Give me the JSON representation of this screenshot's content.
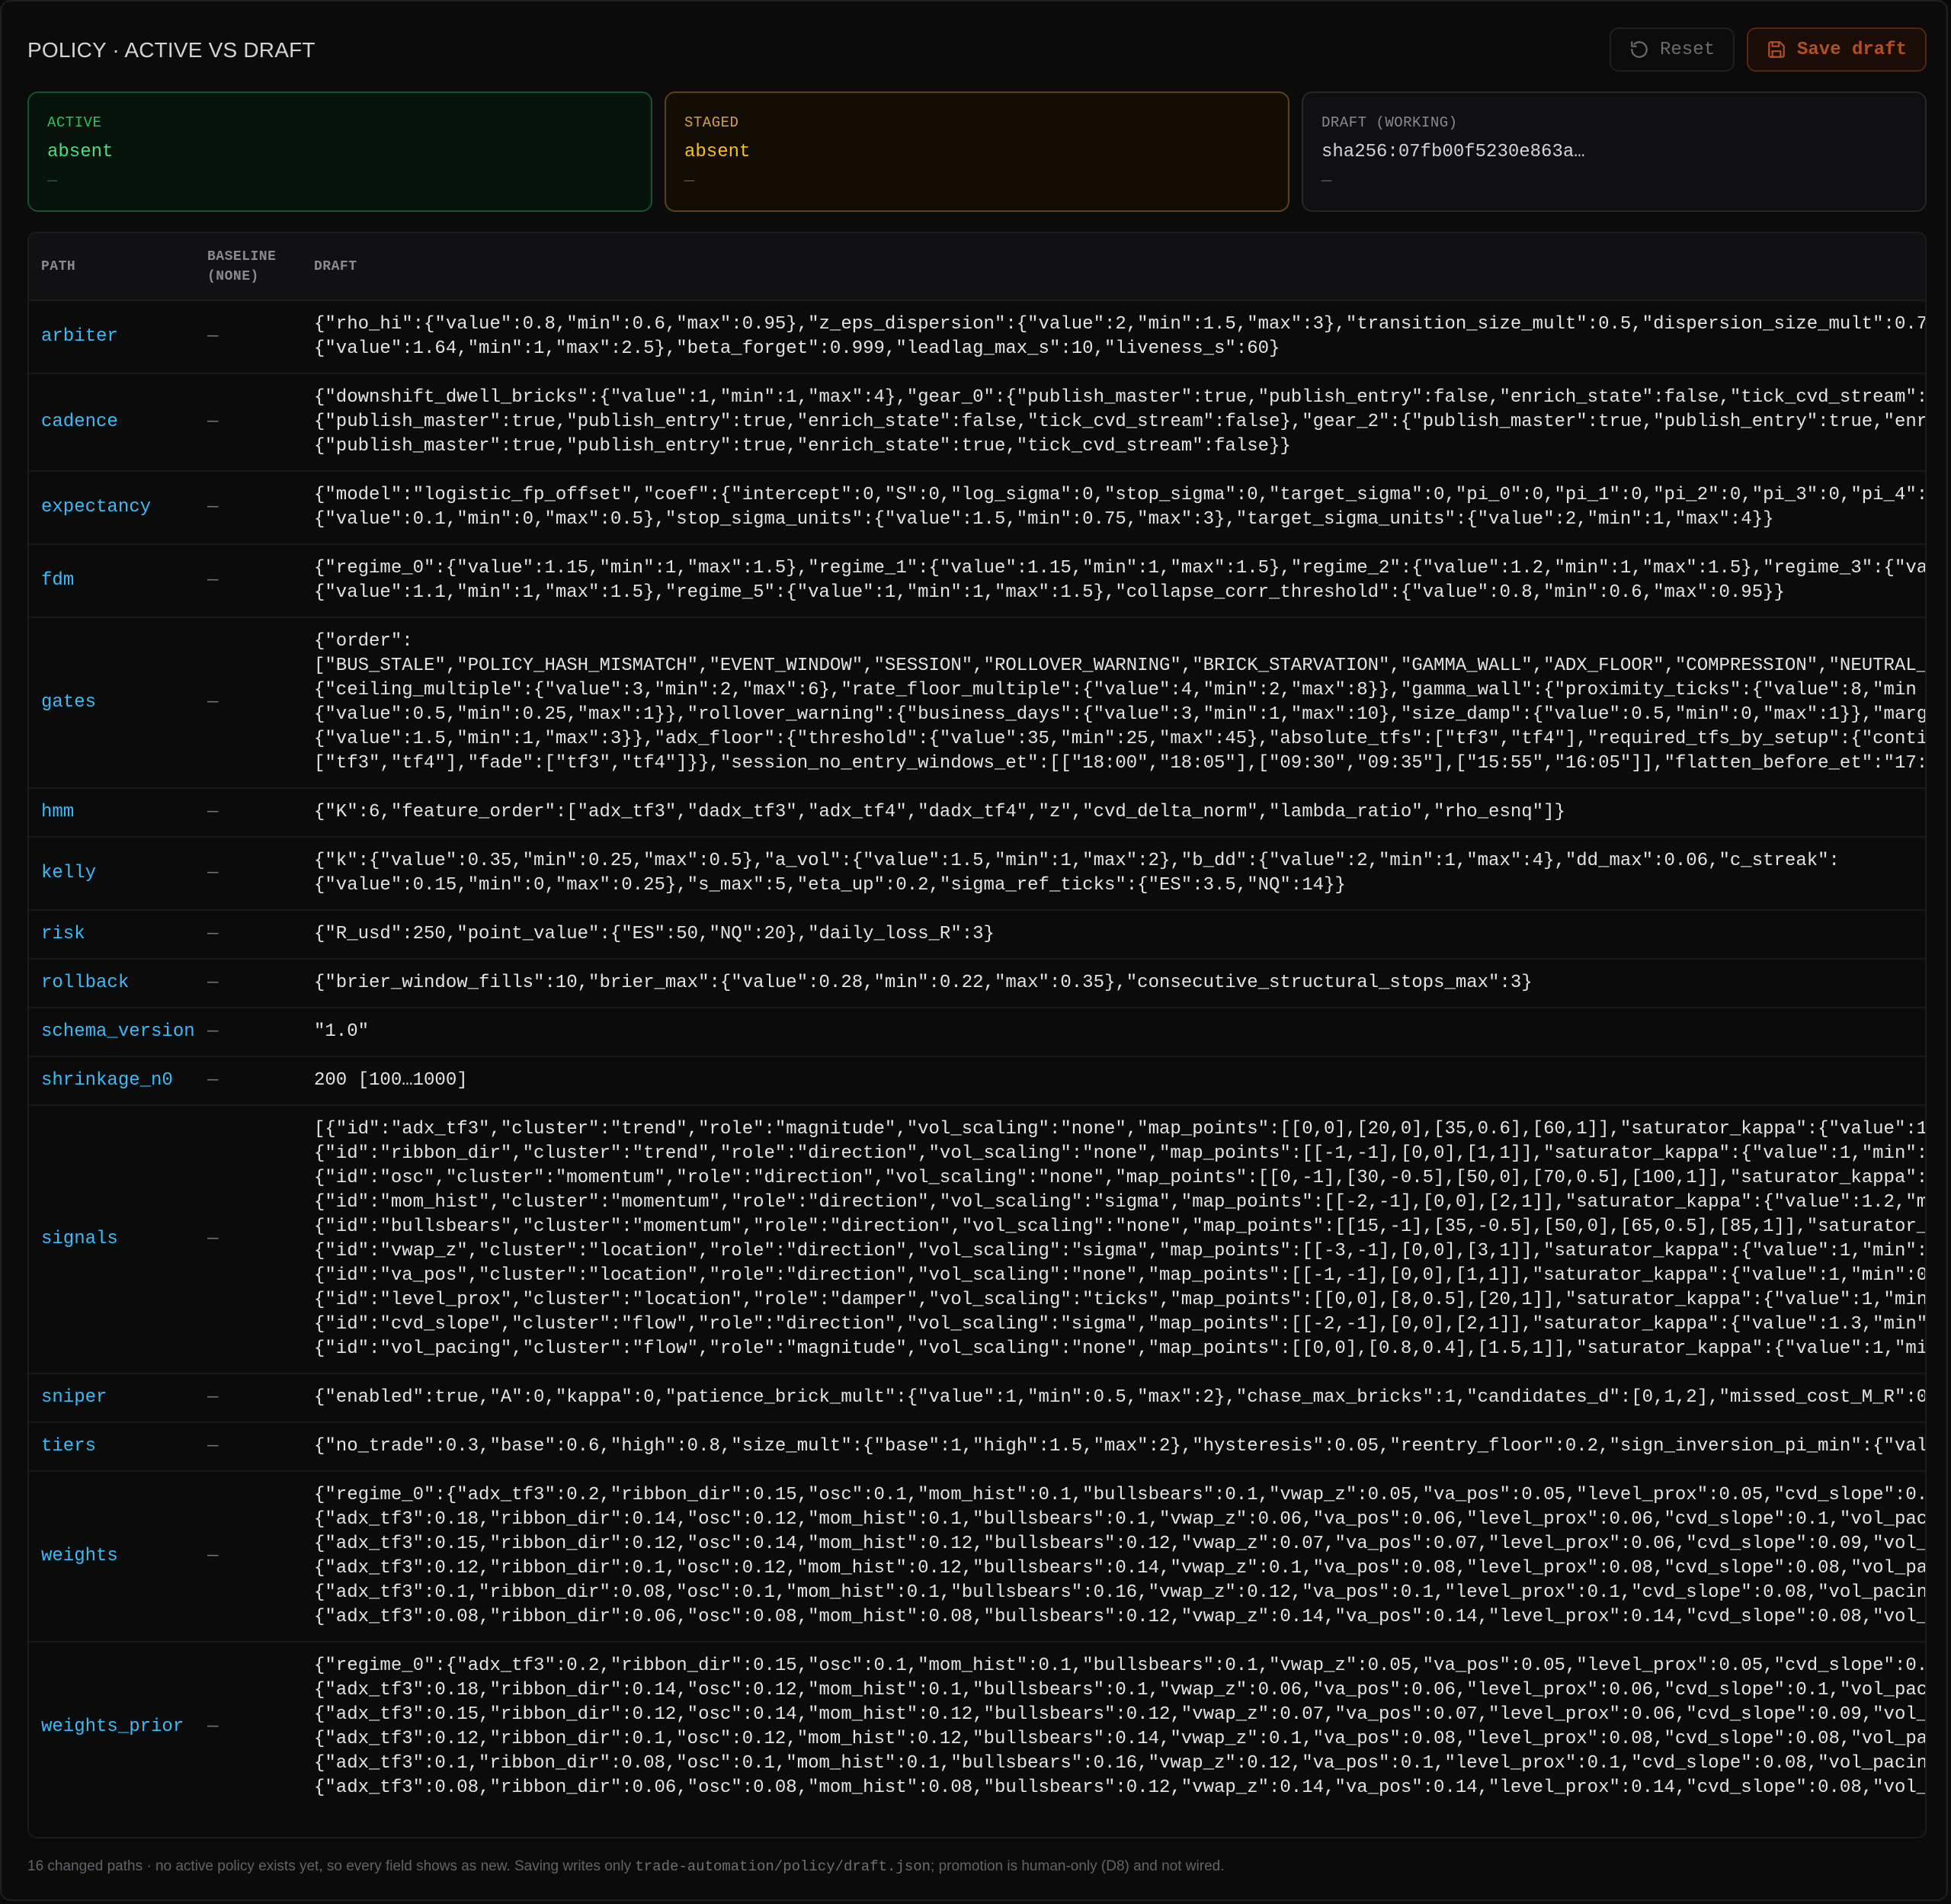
{
  "header": {
    "title": "POLICY · ACTIVE VS DRAFT",
    "reset_label": "Reset",
    "save_label": "Save draft"
  },
  "cards": {
    "active": {
      "label": "ACTIVE",
      "value": "absent",
      "sub": "—"
    },
    "staged": {
      "label": "STAGED",
      "value": "absent",
      "sub": "—"
    },
    "draft": {
      "label": "DRAFT (WORKING)",
      "value": "sha256:07fb00f5230e863a…",
      "sub": "—"
    }
  },
  "table": {
    "columns": {
      "path": "PATH",
      "baseline": "BASELINE\n(NONE)",
      "draft": "DRAFT"
    },
    "rows": [
      {
        "path": "arbiter",
        "baseline": "—",
        "draft": "{\"rho_hi\":{\"value\":0.8,\"min\":0.6,\"max\":0.95},\"z_eps_dispersion\":{\"value\":2,\"min\":1.5,\"max\":3},\"transition_size_mult\":0.5,\"dispersion_size_mult\":0.7\n{\"value\":1.64,\"min\":1,\"max\":2.5},\"beta_forget\":0.999,\"leadlag_max_s\":10,\"liveness_s\":60}"
      },
      {
        "path": "cadence",
        "baseline": "—",
        "draft": "{\"downshift_dwell_bricks\":{\"value\":1,\"min\":1,\"max\":4},\"gear_0\":{\"publish_master\":true,\"publish_entry\":false,\"enrich_state\":false,\"tick_cvd_stream\":\n{\"publish_master\":true,\"publish_entry\":true,\"enrich_state\":false,\"tick_cvd_stream\":false},\"gear_2\":{\"publish_master\":true,\"publish_entry\":true,\"enri\n{\"publish_master\":true,\"publish_entry\":true,\"enrich_state\":true,\"tick_cvd_stream\":false}}"
      },
      {
        "path": "expectancy",
        "baseline": "—",
        "draft": "{\"model\":\"logistic_fp_offset\",\"coef\":{\"intercept\":0,\"S\":0,\"log_sigma\":0,\"stop_sigma\":0,\"target_sigma\":0,\"pi_0\":0,\"pi_1\":0,\"pi_2\":0,\"pi_3\":0,\"pi_4\":\n{\"value\":0.1,\"min\":0,\"max\":0.5},\"stop_sigma_units\":{\"value\":1.5,\"min\":0.75,\"max\":3},\"target_sigma_units\":{\"value\":2,\"min\":1,\"max\":4}}"
      },
      {
        "path": "fdm",
        "baseline": "—",
        "draft": "{\"regime_0\":{\"value\":1.15,\"min\":1,\"max\":1.5},\"regime_1\":{\"value\":1.15,\"min\":1,\"max\":1.5},\"regime_2\":{\"value\":1.2,\"min\":1,\"max\":1.5},\"regime_3\":{\"va\n{\"value\":1.1,\"min\":1,\"max\":1.5},\"regime_5\":{\"value\":1,\"min\":1,\"max\":1.5},\"collapse_corr_threshold\":{\"value\":0.8,\"min\":0.6,\"max\":0.95}}"
      },
      {
        "path": "gates",
        "baseline": "—",
        "draft": "{\"order\":\n[\"BUS_STALE\",\"POLICY_HASH_MISMATCH\",\"EVENT_WINDOW\",\"SESSION\",\"ROLLOVER_WARNING\",\"BRICK_STARVATION\",\"GAMMA_WALL\",\"ADX_FLOOR\",\"COMPRESSION\",\"NEUTRAL_\n{\"ceiling_multiple\":{\"value\":3,\"min\":2,\"max\":6},\"rate_floor_multiple\":{\"value\":4,\"min\":2,\"max\":8}},\"gamma_wall\":{\"proximity_ticks\":{\"value\":8,\"min\n{\"value\":0.5,\"min\":0.25,\"max\":1}},\"rollover_warning\":{\"business_days\":{\"value\":3,\"min\":1,\"max\":10},\"size_damp\":{\"value\":0.5,\"min\":0,\"max\":1}},\"marg\n{\"value\":1.5,\"min\":1,\"max\":3}},\"adx_floor\":{\"threshold\":{\"value\":35,\"min\":25,\"max\":45},\"absolute_tfs\":[\"tf3\",\"tf4\"],\"required_tfs_by_setup\":{\"conti\n[\"tf3\",\"tf4\"],\"fade\":[\"tf3\",\"tf4\"]}},\"session_no_entry_windows_et\":[[\"18:00\",\"18:05\"],[\"09:30\",\"09:35\"],[\"15:55\",\"16:05\"]],\"flatten_before_et\":\"17:"
      },
      {
        "path": "hmm",
        "baseline": "—",
        "draft": "{\"K\":6,\"feature_order\":[\"adx_tf3\",\"dadx_tf3\",\"adx_tf4\",\"dadx_tf4\",\"z\",\"cvd_delta_norm\",\"lambda_ratio\",\"rho_esnq\"]}"
      },
      {
        "path": "kelly",
        "baseline": "—",
        "draft": "{\"k\":{\"value\":0.35,\"min\":0.25,\"max\":0.5},\"a_vol\":{\"value\":1.5,\"min\":1,\"max\":2},\"b_dd\":{\"value\":2,\"min\":1,\"max\":4},\"dd_max\":0.06,\"c_streak\":\n{\"value\":0.15,\"min\":0,\"max\":0.25},\"s_max\":5,\"eta_up\":0.2,\"sigma_ref_ticks\":{\"ES\":3.5,\"NQ\":14}}"
      },
      {
        "path": "risk",
        "baseline": "—",
        "draft": "{\"R_usd\":250,\"point_value\":{\"ES\":50,\"NQ\":20},\"daily_loss_R\":3}"
      },
      {
        "path": "rollback",
        "baseline": "—",
        "draft": "{\"brier_window_fills\":10,\"brier_max\":{\"value\":0.28,\"min\":0.22,\"max\":0.35},\"consecutive_structural_stops_max\":3}"
      },
      {
        "path": "schema_version",
        "baseline": "—",
        "draft": "\"1.0\""
      },
      {
        "path": "shrinkage_n0",
        "baseline": "—",
        "draft": "200 [100…1000]"
      },
      {
        "path": "signals",
        "baseline": "—",
        "draft": "[{\"id\":\"adx_tf3\",\"cluster\":\"trend\",\"role\":\"magnitude\",\"vol_scaling\":\"none\",\"map_points\":[[0,0],[20,0],[35,0.6],[60,1]],\"saturator_kappa\":{\"value\":1\n{\"id\":\"ribbon_dir\",\"cluster\":\"trend\",\"role\":\"direction\",\"vol_scaling\":\"none\",\"map_points\":[[-1,-1],[0,0],[1,1]],\"saturator_kappa\":{\"value\":1,\"min\":\n{\"id\":\"osc\",\"cluster\":\"momentum\",\"role\":\"direction\",\"vol_scaling\":\"none\",\"map_points\":[[0,-1],[30,-0.5],[50,0],[70,0.5],[100,1]],\"saturator_kappa\":\n{\"id\":\"mom_hist\",\"cluster\":\"momentum\",\"role\":\"direction\",\"vol_scaling\":\"sigma\",\"map_points\":[[-2,-1],[0,0],[2,1]],\"saturator_kappa\":{\"value\":1.2,\"m\n{\"id\":\"bullsbears\",\"cluster\":\"momentum\",\"role\":\"direction\",\"vol_scaling\":\"none\",\"map_points\":[[15,-1],[35,-0.5],[50,0],[65,0.5],[85,1]],\"saturator_\n{\"id\":\"vwap_z\",\"cluster\":\"location\",\"role\":\"direction\",\"vol_scaling\":\"sigma\",\"map_points\":[[-3,-1],[0,0],[3,1]],\"saturator_kappa\":{\"value\":1,\"min\":\n{\"id\":\"va_pos\",\"cluster\":\"location\",\"role\":\"direction\",\"vol_scaling\":\"none\",\"map_points\":[[-1,-1],[0,0],[1,1]],\"saturator_kappa\":{\"value\":1,\"min\":0\n{\"id\":\"level_prox\",\"cluster\":\"location\",\"role\":\"damper\",\"vol_scaling\":\"ticks\",\"map_points\":[[0,0],[8,0.5],[20,1]],\"saturator_kappa\":{\"value\":1,\"min\n{\"id\":\"cvd_slope\",\"cluster\":\"flow\",\"role\":\"direction\",\"vol_scaling\":\"sigma\",\"map_points\":[[-2,-1],[0,0],[2,1]],\"saturator_kappa\":{\"value\":1.3,\"min\"\n{\"id\":\"vol_pacing\",\"cluster\":\"flow\",\"role\":\"magnitude\",\"vol_scaling\":\"none\",\"map_points\":[[0,0],[0.8,0.4],[1.5,1]],\"saturator_kappa\":{\"value\":1,\"mi"
      },
      {
        "path": "sniper",
        "baseline": "—",
        "draft": "{\"enabled\":true,\"A\":0,\"kappa\":0,\"patience_brick_mult\":{\"value\":1,\"min\":0.5,\"max\":2},\"chase_max_bricks\":1,\"candidates_d\":[0,1,2],\"missed_cost_M_R\":0"
      },
      {
        "path": "tiers",
        "baseline": "—",
        "draft": "{\"no_trade\":0.3,\"base\":0.6,\"high\":0.8,\"size_mult\":{\"base\":1,\"high\":1.5,\"max\":2},\"hysteresis\":0.05,\"reentry_floor\":0.2,\"sign_inversion_pi_min\":{\"val"
      },
      {
        "path": "weights",
        "baseline": "—",
        "draft": "{\"regime_0\":{\"adx_tf3\":0.2,\"ribbon_dir\":0.15,\"osc\":0.1,\"mom_hist\":0.1,\"bullsbears\":0.1,\"vwap_z\":0.05,\"va_pos\":0.05,\"level_prox\":0.05,\"cvd_slope\":0.\n{\"adx_tf3\":0.18,\"ribbon_dir\":0.14,\"osc\":0.12,\"mom_hist\":0.1,\"bullsbears\":0.1,\"vwap_z\":0.06,\"va_pos\":0.06,\"level_prox\":0.06,\"cvd_slope\":0.1,\"vol_pac\n{\"adx_tf3\":0.15,\"ribbon_dir\":0.12,\"osc\":0.14,\"mom_hist\":0.12,\"bullsbears\":0.12,\"vwap_z\":0.07,\"va_pos\":0.07,\"level_prox\":0.06,\"cvd_slope\":0.09,\"vol_\n{\"adx_tf3\":0.12,\"ribbon_dir\":0.1,\"osc\":0.12,\"mom_hist\":0.12,\"bullsbears\":0.14,\"vwap_z\":0.1,\"va_pos\":0.08,\"level_prox\":0.08,\"cvd_slope\":0.08,\"vol_pa\n{\"adx_tf3\":0.1,\"ribbon_dir\":0.08,\"osc\":0.1,\"mom_hist\":0.1,\"bullsbears\":0.16,\"vwap_z\":0.12,\"va_pos\":0.1,\"level_prox\":0.1,\"cvd_slope\":0.08,\"vol_pacin\n{\"adx_tf3\":0.08,\"ribbon_dir\":0.06,\"osc\":0.08,\"mom_hist\":0.08,\"bullsbears\":0.12,\"vwap_z\":0.14,\"va_pos\":0.14,\"level_prox\":0.14,\"cvd_slope\":0.08,\"vol_"
      },
      {
        "path": "weights_prior",
        "baseline": "—",
        "draft": "{\"regime_0\":{\"adx_tf3\":0.2,\"ribbon_dir\":0.15,\"osc\":0.1,\"mom_hist\":0.1,\"bullsbears\":0.1,\"vwap_z\":0.05,\"va_pos\":0.05,\"level_prox\":0.05,\"cvd_slope\":0.\n{\"adx_tf3\":0.18,\"ribbon_dir\":0.14,\"osc\":0.12,\"mom_hist\":0.1,\"bullsbears\":0.1,\"vwap_z\":0.06,\"va_pos\":0.06,\"level_prox\":0.06,\"cvd_slope\":0.1,\"vol_pac\n{\"adx_tf3\":0.15,\"ribbon_dir\":0.12,\"osc\":0.14,\"mom_hist\":0.12,\"bullsbears\":0.12,\"vwap_z\":0.07,\"va_pos\":0.07,\"level_prox\":0.06,\"cvd_slope\":0.09,\"vol_\n{\"adx_tf3\":0.12,\"ribbon_dir\":0.1,\"osc\":0.12,\"mom_hist\":0.12,\"bullsbears\":0.14,\"vwap_z\":0.1,\"va_pos\":0.08,\"level_prox\":0.08,\"cvd_slope\":0.08,\"vol_pa\n{\"adx_tf3\":0.1,\"ribbon_dir\":0.08,\"osc\":0.1,\"mom_hist\":0.1,\"bullsbears\":0.16,\"vwap_z\":0.12,\"va_pos\":0.1,\"level_prox\":0.1,\"cvd_slope\":0.08,\"vol_pacin\n{\"adx_tf3\":0.08,\"ribbon_dir\":0.06,\"osc\":0.08,\"mom_hist\":0.08,\"bullsbears\":0.12,\"vwap_z\":0.14,\"va_pos\":0.14,\"level_prox\":0.14,\"cvd_slope\":0.08,\"vol_"
      }
    ]
  },
  "footer": {
    "text_before": "16 changed paths · no active policy exists yet, so every field shows as new. Saving writes only ",
    "file_path": "trade-automation/policy/draft.json",
    "text_after": "; promotion is human-only (D8) and not wired."
  },
  "colors": {
    "accent_save": "#b4501f",
    "active_green": "#4ade80",
    "staged_amber": "#fbbf24",
    "path_cyan": "#38bdf8"
  },
  "icons": {
    "reset": "rotate-ccw-icon",
    "save": "save-disk-icon"
  }
}
